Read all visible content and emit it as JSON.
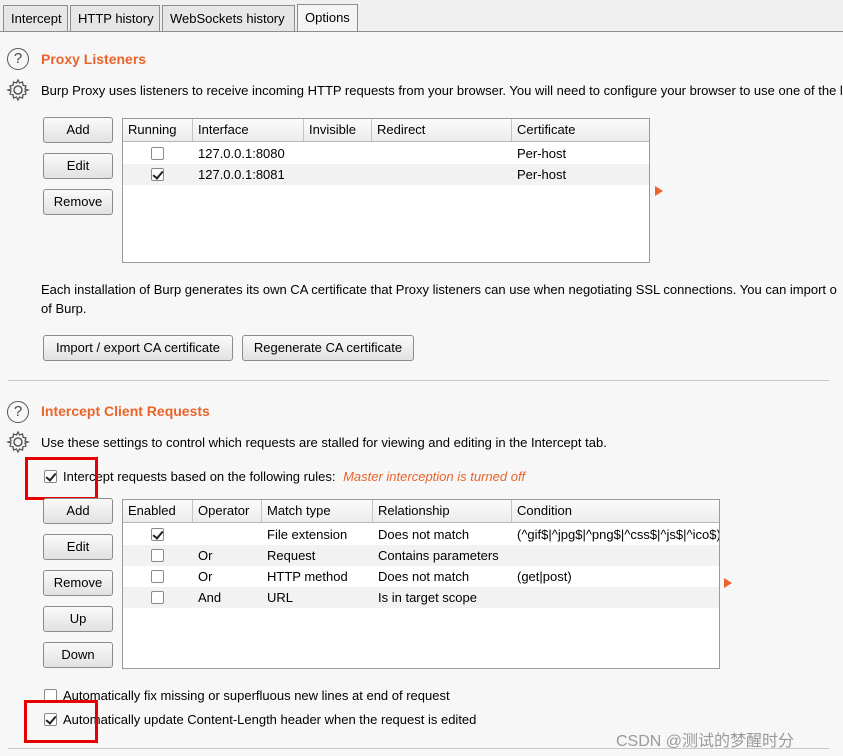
{
  "tabs": [
    "Intercept",
    "HTTP history",
    "WebSockets history",
    "Options"
  ],
  "proxy_listeners": {
    "title": "Proxy Listeners",
    "description": "Burp Proxy uses listeners to receive incoming HTTP requests from your browser. You will need to configure your browser to use one of the l",
    "buttons": {
      "add": "Add",
      "edit": "Edit",
      "remove": "Remove"
    },
    "columns": [
      "Running",
      "Interface",
      "Invisible",
      "Redirect",
      "Certificate"
    ],
    "rows": [
      {
        "running": false,
        "interface": "127.0.0.1:8080",
        "invisible": "",
        "redirect": "",
        "certificate": "Per-host"
      },
      {
        "running": true,
        "interface": "127.0.0.1:8081",
        "invisible": "",
        "redirect": "",
        "certificate": "Per-host"
      }
    ],
    "ca_text_1": "Each installation of Burp generates its own CA certificate that Proxy listeners can use when negotiating SSL connections. You can import o",
    "ca_text_2": "of Burp.",
    "import_export_button": "Import / export CA certificate",
    "regenerate_button": "Regenerate CA certificate"
  },
  "intercept_client": {
    "title": "Intercept Client Requests",
    "description": "Use these settings to control which requests are stalled for viewing and editing in the Intercept tab.",
    "intercept_rules_label": "Intercept requests based on the following rules:",
    "intercept_rules_checked": true,
    "master_note": "Master interception is turned off",
    "buttons": {
      "add": "Add",
      "edit": "Edit",
      "remove": "Remove",
      "up": "Up",
      "down": "Down"
    },
    "columns": [
      "Enabled",
      "Operator",
      "Match type",
      "Relationship",
      "Condition"
    ],
    "rows": [
      {
        "enabled": true,
        "operator": "",
        "match_type": "File extension",
        "relationship": "Does not match",
        "condition": "(^gif$|^jpg$|^png$|^css$|^js$|^ico$)"
      },
      {
        "enabled": false,
        "operator": "Or",
        "match_type": "Request",
        "relationship": "Contains parameters",
        "condition": ""
      },
      {
        "enabled": false,
        "operator": "Or",
        "match_type": "HTTP method",
        "relationship": "Does not match",
        "condition": "(get|post)"
      },
      {
        "enabled": false,
        "operator": "And",
        "match_type": "URL",
        "relationship": "Is in target scope",
        "condition": ""
      }
    ],
    "fix_newlines_label": "Automatically fix missing or superfluous new lines at end of request",
    "fix_newlines_checked": false,
    "update_length_label": "Automatically update Content-Length header when the request is edited",
    "update_length_checked": true
  },
  "watermark": "CSDN @测试的梦醒时分",
  "colors": {
    "accent": "#e8642b",
    "highlight": "#e60000"
  }
}
